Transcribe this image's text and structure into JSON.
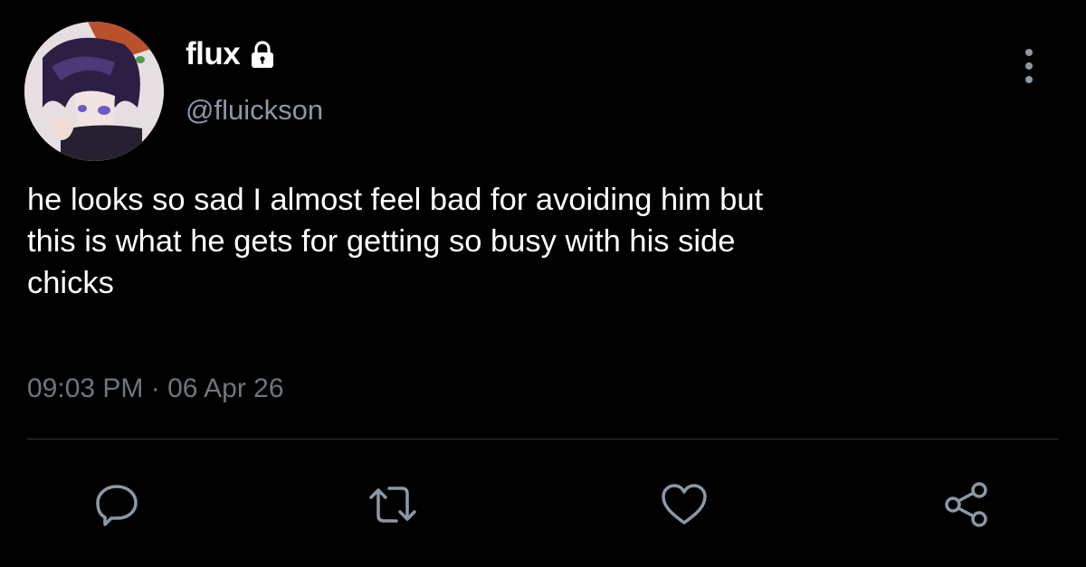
{
  "tweet": {
    "display_name": "flux",
    "handle": "@fluickson",
    "text": "he looks so sad I almost feel bad for avoiding him but\nthis is what he gets for getting so busy with his side\nchicks",
    "time": "09:03 PM",
    "separator": "·",
    "date": "06 Apr 26",
    "protected_icon": "lock-icon",
    "avatar": "anime-character-avatar"
  },
  "actions": {
    "reply_icon": "reply-icon",
    "retweet_icon": "retweet-icon",
    "like_icon": "heart-icon",
    "share_icon": "share-icon"
  },
  "colors": {
    "background": "#000000",
    "text": "#ffffff",
    "secondary": "#8b98a5",
    "meta": "#6e767d",
    "icon": "#8b98a5",
    "divider": "#2f3336"
  }
}
